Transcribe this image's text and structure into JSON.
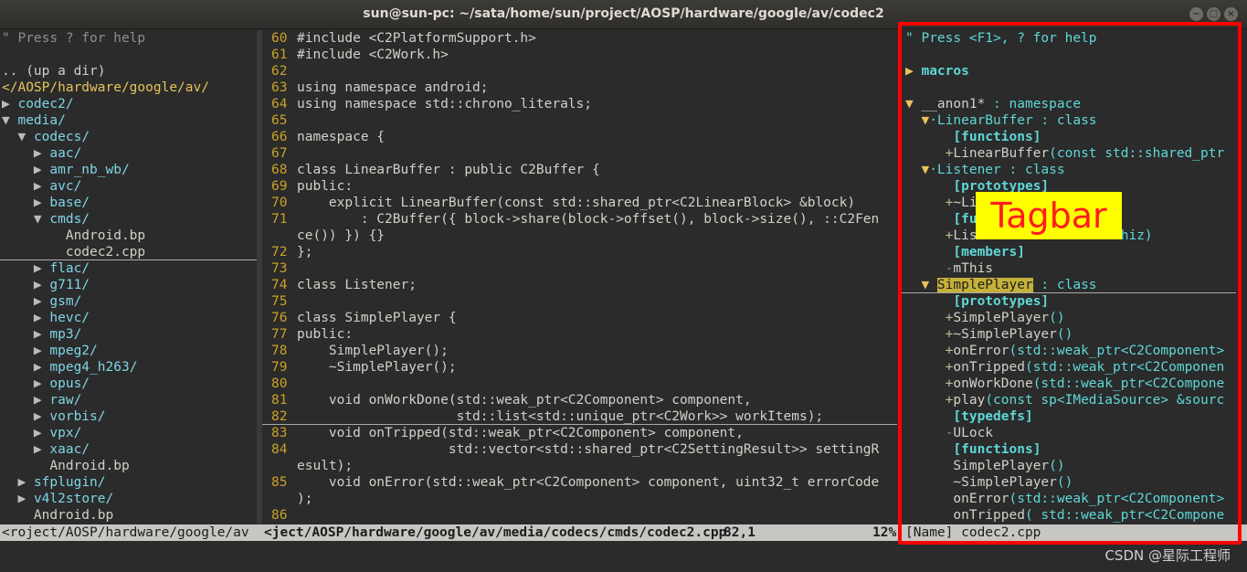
{
  "window": {
    "title": "sun@sun-pc: ~/sata/home/sun/project/AOSP/hardware/google/av/codec2",
    "buttons": [
      "−",
      "□",
      "×"
    ]
  },
  "tree": {
    "help": "\" Press ? for help",
    "lines": [
      {
        "text": "",
        "cls": ""
      },
      {
        "text": ".. (up a dir)",
        "cls": "c-file"
      },
      {
        "text": "</AOSP/hardware/google/av/",
        "cls": "c-path"
      },
      {
        "arrow": "▶ ",
        "text": "codec2/",
        "cls": "c-dir"
      },
      {
        "arrow": "▼ ",
        "text": "media/",
        "cls": "c-dir"
      },
      {
        "indent": "  ",
        "arrow": "▼ ",
        "text": "codecs/",
        "cls": "c-dir"
      },
      {
        "indent": "    ",
        "arrow": "▶ ",
        "text": "aac/",
        "cls": "c-dir"
      },
      {
        "indent": "    ",
        "arrow": "▶ ",
        "text": "amr_nb_wb/",
        "cls": "c-dir"
      },
      {
        "indent": "    ",
        "arrow": "▶ ",
        "text": "avc/",
        "cls": "c-dir"
      },
      {
        "indent": "    ",
        "arrow": "▶ ",
        "text": "base/",
        "cls": "c-dir"
      },
      {
        "indent": "    ",
        "arrow": "▼ ",
        "text": "cmds/",
        "cls": "c-dir"
      },
      {
        "indent": "        ",
        "text": "Android.bp",
        "cls": "c-file"
      },
      {
        "indent": "        ",
        "text": "codec2.cpp",
        "cls": "c-file",
        "underline": true
      },
      {
        "indent": "    ",
        "arrow": "▶ ",
        "text": "flac/",
        "cls": "c-dir"
      },
      {
        "indent": "    ",
        "arrow": "▶ ",
        "text": "g711/",
        "cls": "c-dir"
      },
      {
        "indent": "    ",
        "arrow": "▶ ",
        "text": "gsm/",
        "cls": "c-dir"
      },
      {
        "indent": "    ",
        "arrow": "▶ ",
        "text": "hevc/",
        "cls": "c-dir"
      },
      {
        "indent": "    ",
        "arrow": "▶ ",
        "text": "mp3/",
        "cls": "c-dir"
      },
      {
        "indent": "    ",
        "arrow": "▶ ",
        "text": "mpeg2/",
        "cls": "c-dir"
      },
      {
        "indent": "    ",
        "arrow": "▶ ",
        "text": "mpeg4_h263/",
        "cls": "c-dir"
      },
      {
        "indent": "    ",
        "arrow": "▶ ",
        "text": "opus/",
        "cls": "c-dir"
      },
      {
        "indent": "    ",
        "arrow": "▶ ",
        "text": "raw/",
        "cls": "c-dir"
      },
      {
        "indent": "    ",
        "arrow": "▶ ",
        "text": "vorbis/",
        "cls": "c-dir"
      },
      {
        "indent": "    ",
        "arrow": "▶ ",
        "text": "vpx/",
        "cls": "c-dir"
      },
      {
        "indent": "    ",
        "arrow": "▶ ",
        "text": "xaac/",
        "cls": "c-dir"
      },
      {
        "indent": "      ",
        "text": "Android.bp",
        "cls": "c-file"
      },
      {
        "indent": "  ",
        "arrow": "▶ ",
        "text": "sfplugin/",
        "cls": "c-dir"
      },
      {
        "indent": "  ",
        "arrow": "▶ ",
        "text": "v4l2store/",
        "cls": "c-dir"
      },
      {
        "indent": "    ",
        "text": "Android.bp",
        "cls": "c-file"
      }
    ]
  },
  "code": {
    "lines": [
      {
        "n": "60",
        "text": "#include <C2PlatformSupport.h>"
      },
      {
        "n": "61",
        "text": "#include <C2Work.h>"
      },
      {
        "n": "62",
        "text": ""
      },
      {
        "n": "63",
        "text": "using namespace android;"
      },
      {
        "n": "64",
        "text": "using namespace std::chrono_literals;"
      },
      {
        "n": "65",
        "text": ""
      },
      {
        "n": "66",
        "text": "namespace {"
      },
      {
        "n": "67",
        "text": ""
      },
      {
        "n": "68",
        "text": "class LinearBuffer : public C2Buffer {"
      },
      {
        "n": "69",
        "text": "public:"
      },
      {
        "n": "70",
        "text": "    explicit LinearBuffer(const std::shared_ptr<C2LinearBlock> &block)"
      },
      {
        "n": "71",
        "text": "        : C2Buffer({ block->share(block->offset(), block->size(), ::C2Fen"
      },
      {
        "n": "",
        "text": "ce()) }) {}"
      },
      {
        "n": "72",
        "text": "};"
      },
      {
        "n": "73",
        "text": ""
      },
      {
        "n": "74",
        "text": "class Listener;"
      },
      {
        "n": "75",
        "text": ""
      },
      {
        "n": "76",
        "text": "class SimplePlayer {"
      },
      {
        "n": "77",
        "text": "public:"
      },
      {
        "n": "78",
        "text": "    SimplePlayer();"
      },
      {
        "n": "79",
        "text": "    ~SimplePlayer();"
      },
      {
        "n": "80",
        "text": ""
      },
      {
        "n": "81",
        "text": "    void onWorkDone(std::weak_ptr<C2Component> component,"
      },
      {
        "n": "82",
        "text": "                    std::list<std::unique_ptr<C2Work>> workItems);"
      },
      {
        "n": "83",
        "text": "    void onTripped(std::weak_ptr<C2Component> component,"
      },
      {
        "n": "84",
        "text": "                   std::vector<std::shared_ptr<C2SettingResult>> settingR"
      },
      {
        "n": "",
        "text": "esult);"
      },
      {
        "n": "85",
        "text": "    void onError(std::weak_ptr<C2Component> component, uint32_t errorCode"
      },
      {
        "n": "",
        "text": ");"
      },
      {
        "n": "86",
        "text": ""
      }
    ]
  },
  "tagbar": {
    "label": "Tagbar",
    "lines": [
      {
        "parts": [
          [
            "c-teal",
            "\" Press <F1>, ? for help"
          ]
        ]
      },
      {
        "parts": [
          [
            "",
            ""
          ]
        ]
      },
      {
        "parts": [
          [
            "c-yellow-b",
            "▶ "
          ],
          [
            "c-teal-b",
            "macros"
          ]
        ]
      },
      {
        "parts": [
          [
            "",
            ""
          ]
        ]
      },
      {
        "parts": [
          [
            "c-yellow-b",
            "▼ "
          ],
          [
            "c-file",
            "__anon1* "
          ],
          [
            "c-teal",
            ": namespace"
          ]
        ]
      },
      {
        "parts": [
          [
            "c-yellow-b",
            "  ▼"
          ],
          [
            "c-teal",
            "·LinearBuffer : class"
          ]
        ]
      },
      {
        "parts": [
          [
            "",
            "      "
          ],
          [
            "c-teal-b",
            "[functions]"
          ]
        ]
      },
      {
        "parts": [
          [
            "",
            "     "
          ],
          [
            "c-lg",
            "+"
          ],
          [
            "c-file",
            "LinearBuffer"
          ],
          [
            "c-teal",
            "(const std::shared_ptr"
          ]
        ]
      },
      {
        "parts": [
          [
            "c-yellow-b",
            "  ▼"
          ],
          [
            "c-teal",
            "·Listener : class"
          ]
        ]
      },
      {
        "parts": [
          [
            "",
            "      "
          ],
          [
            "c-teal-b",
            "[prototypes]"
          ]
        ]
      },
      {
        "parts": [
          [
            "",
            "     "
          ],
          [
            "c-lg",
            "+"
          ],
          [
            "c-file",
            "~Li"
          ]
        ]
      },
      {
        "parts": [
          [
            "",
            "      "
          ],
          [
            "c-teal-b",
            "[fu"
          ]
        ]
      },
      {
        "parts": [
          [
            "",
            "     "
          ],
          [
            "c-lg",
            "+"
          ],
          [
            "c-file",
            "Lis"
          ],
          [
            "c-teal",
            "                *thiz)"
          ]
        ]
      },
      {
        "parts": [
          [
            "",
            "      "
          ],
          [
            "c-teal-b",
            "[members]"
          ]
        ]
      },
      {
        "parts": [
          [
            "",
            "     "
          ],
          [
            "c-comment",
            "-"
          ],
          [
            "c-file",
            "mThis"
          ]
        ]
      },
      {
        "parts": [
          [
            "c-yellow-b",
            "  ▼ "
          ],
          [
            "c-hl",
            "SimplePlayer"
          ],
          [
            "c-teal",
            " : class"
          ]
        ],
        "underline": true
      },
      {
        "parts": [
          [
            "",
            "      "
          ],
          [
            "c-teal-b",
            "[prototypes]"
          ]
        ]
      },
      {
        "parts": [
          [
            "",
            "     "
          ],
          [
            "c-lg",
            "+"
          ],
          [
            "c-file",
            "SimplePlayer"
          ],
          [
            "c-teal",
            "()"
          ]
        ]
      },
      {
        "parts": [
          [
            "",
            "     "
          ],
          [
            "c-lg",
            "+"
          ],
          [
            "c-file",
            "~SimplePlayer"
          ],
          [
            "c-teal",
            "()"
          ]
        ]
      },
      {
        "parts": [
          [
            "",
            "     "
          ],
          [
            "c-lg",
            "+"
          ],
          [
            "c-file",
            "onError"
          ],
          [
            "c-teal",
            "(std::weak_ptr<C2Component>"
          ]
        ]
      },
      {
        "parts": [
          [
            "",
            "     "
          ],
          [
            "c-lg",
            "+"
          ],
          [
            "c-file",
            "onTripped"
          ],
          [
            "c-teal",
            "(std::weak_ptr<C2Componen"
          ]
        ]
      },
      {
        "parts": [
          [
            "",
            "     "
          ],
          [
            "c-lg",
            "+"
          ],
          [
            "c-file",
            "onWorkDone"
          ],
          [
            "c-teal",
            "(std::weak_ptr<C2Compone"
          ]
        ]
      },
      {
        "parts": [
          [
            "",
            "     "
          ],
          [
            "c-lg",
            "+"
          ],
          [
            "c-file",
            "play"
          ],
          [
            "c-teal",
            "(const sp<IMediaSource> &sourc"
          ]
        ]
      },
      {
        "parts": [
          [
            "",
            "      "
          ],
          [
            "c-teal-b",
            "[typedefs]"
          ]
        ]
      },
      {
        "parts": [
          [
            "",
            "     "
          ],
          [
            "c-comment",
            "-"
          ],
          [
            "c-file",
            "ULock"
          ]
        ]
      },
      {
        "parts": [
          [
            "",
            "      "
          ],
          [
            "c-teal-b",
            "[functions]"
          ]
        ]
      },
      {
        "parts": [
          [
            "",
            "      "
          ],
          [
            "c-file",
            "SimplePlayer"
          ],
          [
            "c-teal",
            "()"
          ]
        ]
      },
      {
        "parts": [
          [
            "",
            "      "
          ],
          [
            "c-file",
            "~SimplePlayer"
          ],
          [
            "c-teal",
            "()"
          ]
        ]
      },
      {
        "parts": [
          [
            "",
            "      "
          ],
          [
            "c-file",
            "onError"
          ],
          [
            "c-teal",
            "(std::weak_ptr<C2Component>"
          ]
        ]
      },
      {
        "parts": [
          [
            "",
            "      "
          ],
          [
            "c-file",
            "onTripped"
          ],
          [
            "c-teal",
            "( std::weak_ptr<C2Compone"
          ]
        ]
      }
    ]
  },
  "status": {
    "left": "<roject/AOSP/hardware/google/av",
    "mid": "<ject/AOSP/hardware/google/av/media/codecs/cmds/codec2.cpp",
    "pos": "82,1",
    "pct": "12%",
    "tag": "[Name] codec2.cpp"
  },
  "watermark": "CSDN @星际工程师",
  "colors": {
    "highlight": "#c5b13a",
    "frame": "#ff0000",
    "label_bg": "#ffff00"
  }
}
